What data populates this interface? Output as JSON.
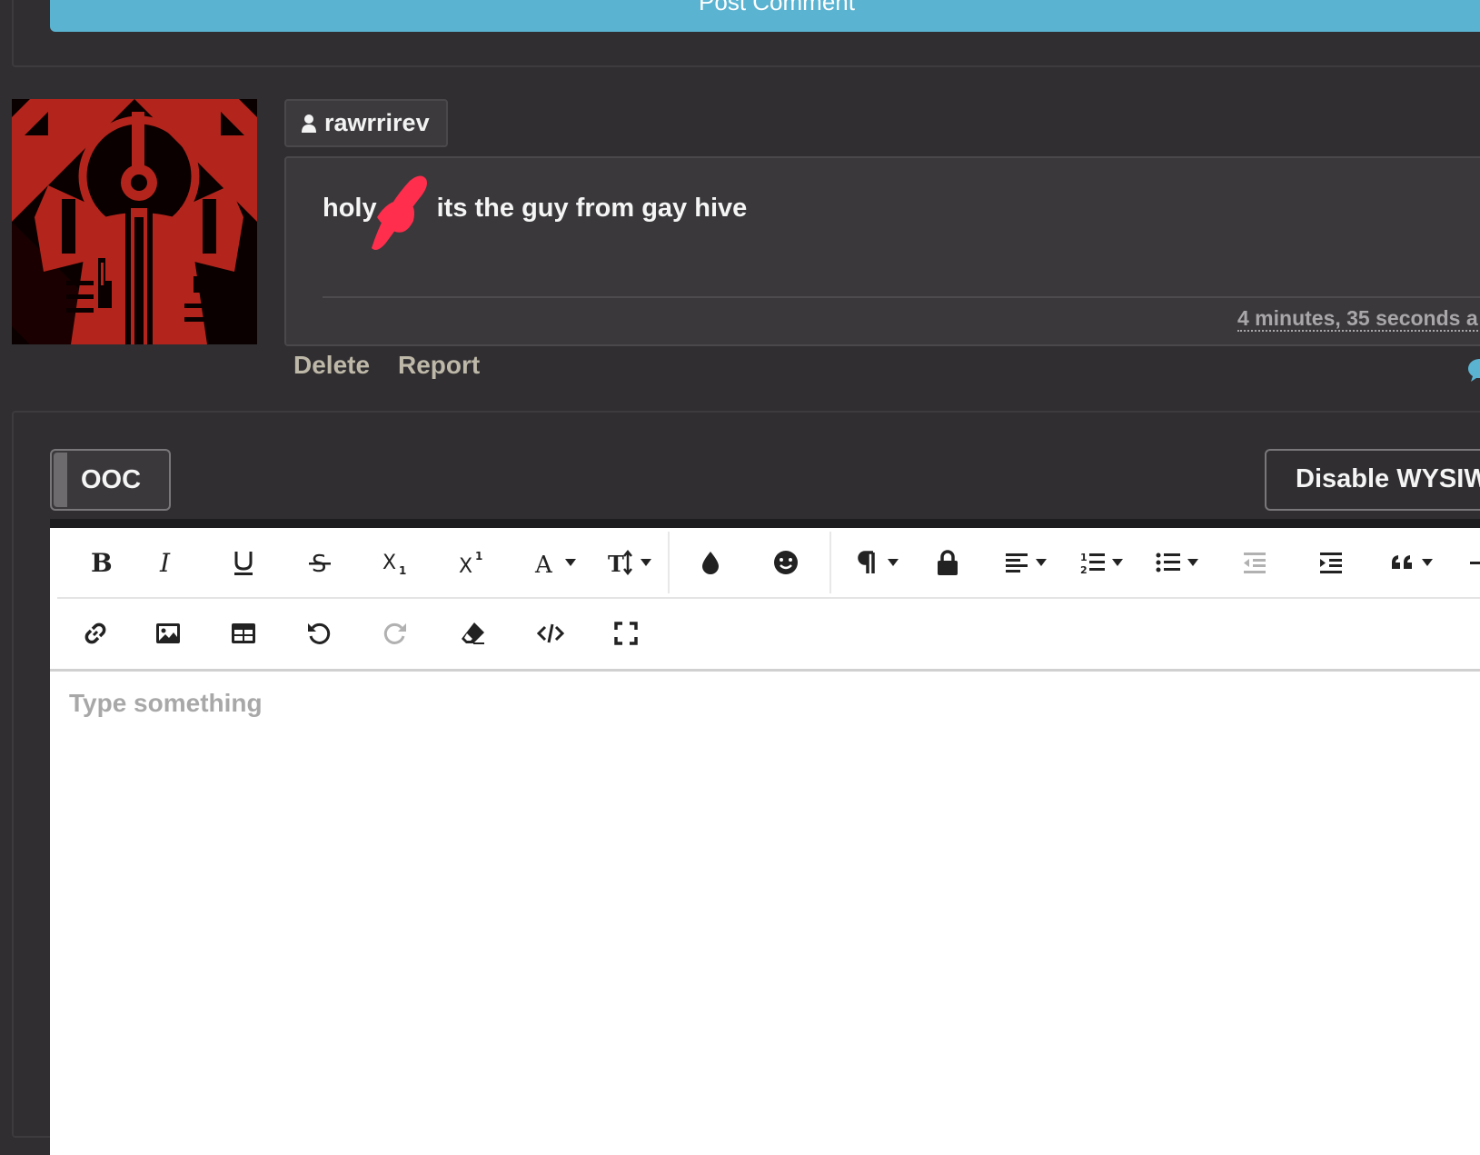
{
  "post_comment": {
    "label": "Post Comment"
  },
  "comment": {
    "username": "rawrrirev",
    "text_before": "holy",
    "text_after": "its the guy from gay hive",
    "timestamp": "4 minutes, 35 seconds a",
    "actions": {
      "delete": "Delete",
      "report": "Report"
    }
  },
  "editor": {
    "ooc_label": "OOC",
    "wysiwyg_label": "Disable WYSIWYG",
    "placeholder": "Type something",
    "toolbar_row1": [
      "bold-icon",
      "italic-icon",
      "underline-icon",
      "strikethrough-icon",
      "subscript-icon",
      "superscript-icon",
      "font-family-icon",
      "font-size-icon",
      "text-color-icon",
      "emoji-icon",
      "paragraph-format-icon",
      "lock-icon",
      "align-icon",
      "ordered-list-icon",
      "unordered-list-icon",
      "outdent-icon",
      "indent-icon",
      "quote-icon"
    ],
    "toolbar_row2": [
      "link-icon",
      "image-icon",
      "table-icon",
      "undo-icon",
      "redo-icon",
      "clear-format-icon",
      "code-view-icon",
      "fullscreen-icon"
    ]
  },
  "colors": {
    "background": "#302e31",
    "accent_button": "#5ab3d1",
    "avatar_red": "#b3251c",
    "censor_scribble": "#ff2e4d"
  }
}
